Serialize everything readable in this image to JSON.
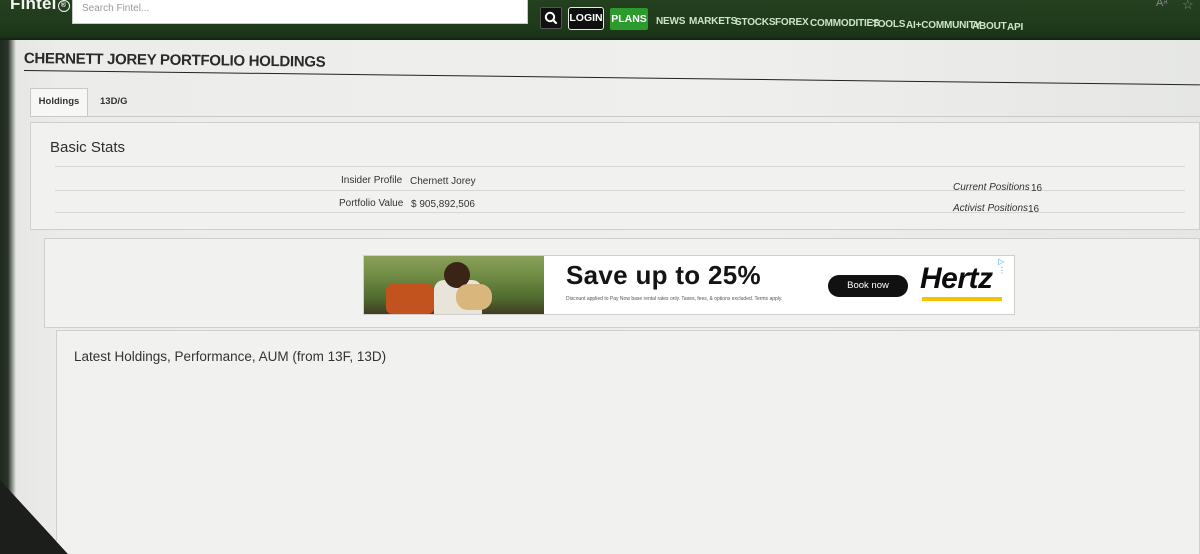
{
  "navbar": {
    "logo": "Fintel",
    "logo_mark": "®",
    "search_placeholder": "Search Fintel...",
    "login": "LOGIN",
    "plans": "PLANS",
    "links": [
      "NEWS",
      "MARKETS",
      "STOCKS",
      "FOREX",
      "COMMODITIES",
      "TOOLS",
      "AI+COMMUNITY",
      "ABOUT",
      "API"
    ],
    "font_icon": "Aᵃ",
    "star_icon": "☆"
  },
  "page": {
    "title": "CHERNETT JOREY PORTFOLIO HOLDINGS"
  },
  "tabs": [
    "Holdings",
    "13D/G"
  ],
  "basic_stats": {
    "title": "Basic Stats",
    "insider_profile_label": "Insider Profile",
    "insider_profile_value": "Chernett Jorey",
    "portfolio_value_label": "Portfolio Value",
    "portfolio_value_value": "$ 905,892,506",
    "current_positions_label": "Current Positions",
    "current_positions_value": "16",
    "activist_positions_label": "Activist Positions",
    "activist_positions_value": "16"
  },
  "ad": {
    "headline": "Save up to 25%",
    "fine_print": "Discount applied to Pay Now base rental rates only. Taxes, fees, & options excluded. Terms apply.",
    "cta": "Book now",
    "brand": "Hertz",
    "choices": "▷ ⋮",
    "brand_color": "#f2c400"
  },
  "holdings": {
    "title": "Latest Holdings, Performance, AUM (from 13F, 13D)"
  },
  "colors": {
    "nav_bg": "#1f3a1b",
    "plans_bg": "#2c9a2c",
    "nav_text": "#cfe3c6"
  }
}
